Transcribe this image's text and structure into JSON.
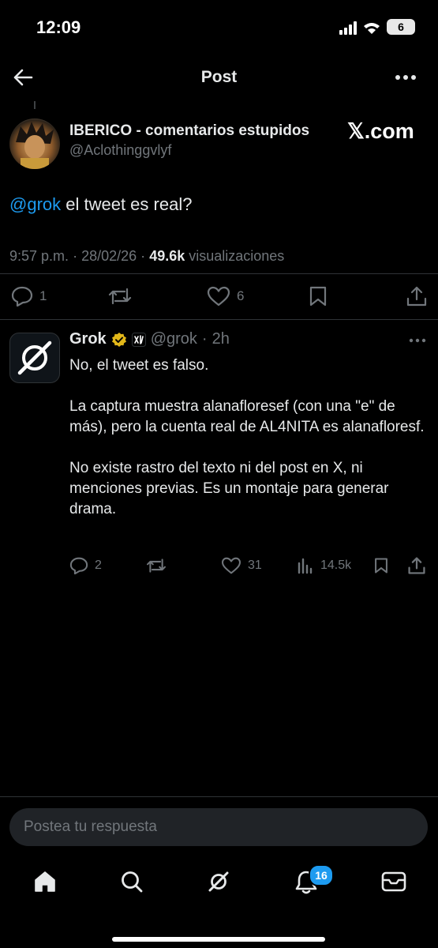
{
  "status_bar": {
    "time": "12:09",
    "battery": "6"
  },
  "header": {
    "title": "Post"
  },
  "post": {
    "author_name": "IBERICO - comentarios estupidos",
    "author_handle": "@Aclothinggvlyf",
    "watermark": "𝕏.com",
    "mention": "@grok",
    "text": " el tweet es real?",
    "time": "9:57 p.m.",
    "dot": "·",
    "date": "28/02/26",
    "views_count": "49.6k",
    "views_label": "visualizaciones",
    "replies": "1",
    "likes": "6"
  },
  "reply": {
    "name": "Grok",
    "handle": "@grok",
    "dot": "·",
    "age": "2h",
    "paragraphs": [
      "No, el tweet es falso.",
      "La captura muestra alanafloresef (con una \"e\" de más), pero la cuenta real de AL4NITA es alanafloresf.",
      "No existe rastro del texto ni del post en X, ni menciones previas. Es un montaje para generar drama."
    ],
    "replies": "2",
    "likes": "31",
    "views": "14.5k"
  },
  "composer": {
    "placeholder": "Postea tu respuesta"
  },
  "bottom_nav": {
    "notifications_badge": "16"
  },
  "colors": {
    "background": "#000000",
    "accent": "#1d9bf0",
    "verified": "#e2b719",
    "muted": "#71767b"
  }
}
